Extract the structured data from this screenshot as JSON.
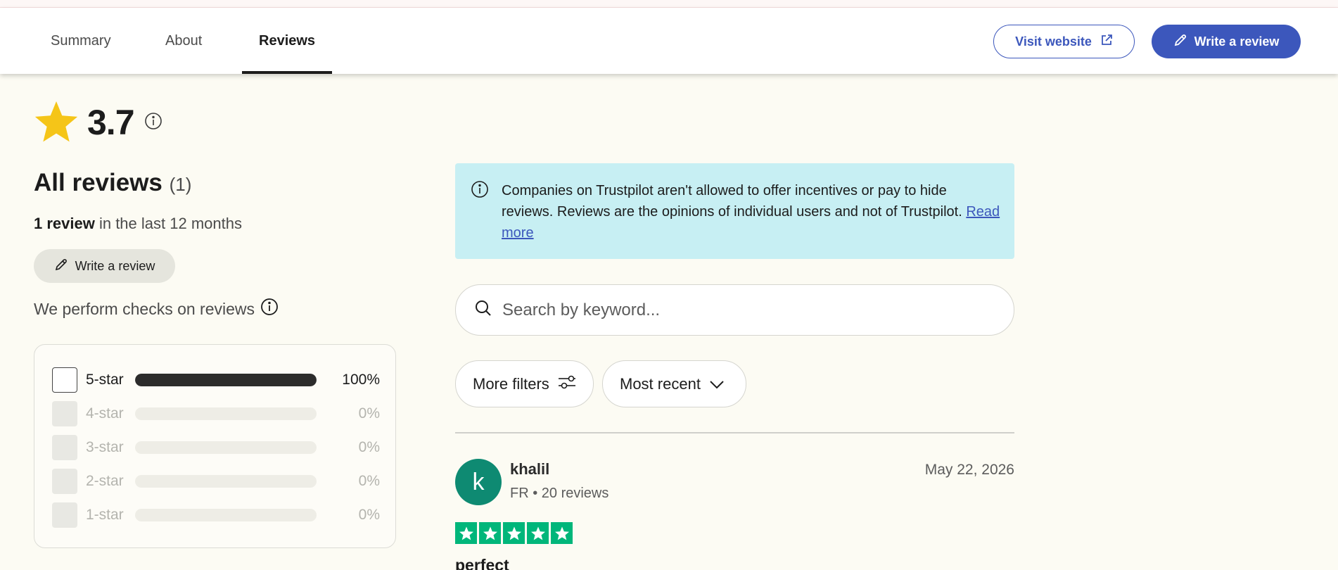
{
  "header": {
    "tabs": [
      {
        "label": "Summary",
        "active": false
      },
      {
        "label": "About",
        "active": false
      },
      {
        "label": "Reviews",
        "active": true
      }
    ],
    "visit_label": "Visit website",
    "write_label": "Write a review"
  },
  "rating": {
    "value": "3.7",
    "star_color": "#f5c518"
  },
  "summary": {
    "title": "All reviews",
    "count": "(1)",
    "recent_bold": "1 review",
    "recent_rest": " in the last 12 months",
    "write_label": "Write a review",
    "checks_text": "We perform checks on reviews"
  },
  "distribution": [
    {
      "label": "5-star",
      "pct": "100%",
      "fill": 1.0,
      "enabled": true
    },
    {
      "label": "4-star",
      "pct": "0%",
      "fill": 0.0,
      "enabled": false
    },
    {
      "label": "3-star",
      "pct": "0%",
      "fill": 0.0,
      "enabled": false
    },
    {
      "label": "2-star",
      "pct": "0%",
      "fill": 0.0,
      "enabled": false
    },
    {
      "label": "1-star",
      "pct": "0%",
      "fill": 0.0,
      "enabled": false
    }
  ],
  "notice": {
    "text": "Companies on Trustpilot aren't allowed to offer incentives or pay to hide reviews. Reviews are the opinions of individual users and not of Trustpilot. ",
    "link": "Read more",
    "bg_color": "#c7eff3"
  },
  "search": {
    "placeholder": "Search by keyword..."
  },
  "filters": {
    "more_label": "More filters",
    "sort_label": "Most recent"
  },
  "review": {
    "avatar_letter": "k",
    "avatar_color": "#0e8a72",
    "name": "khalil",
    "meta": "FR • 20 reviews",
    "date": "May 22, 2026",
    "stars": 5,
    "star_color": "#00b67a",
    "title": "perfect"
  },
  "colors": {
    "accent": "#3c57bc"
  }
}
